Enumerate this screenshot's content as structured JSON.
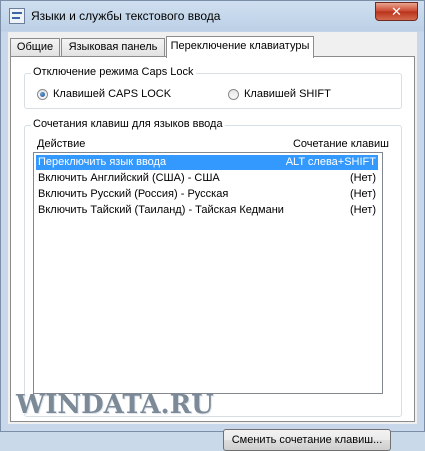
{
  "window": {
    "title": "Языки и службы текстового ввода",
    "close_symbol": "✕"
  },
  "tabs": [
    {
      "label": "Общие",
      "active": false
    },
    {
      "label": "Языковая панель",
      "active": false
    },
    {
      "label": "Переключение клавиатуры",
      "active": true
    }
  ],
  "caps_lock": {
    "group_title": "Отключение режима Caps Lock",
    "options": [
      {
        "label": "Клавишей CAPS LOCK",
        "selected": true
      },
      {
        "label": "Клавишей SHIFT",
        "selected": false
      }
    ]
  },
  "hotkeys": {
    "group_title": "Сочетания клавиш для языков ввода",
    "columns": [
      "Действие",
      "Сочетание клавиш"
    ],
    "rows": [
      {
        "action": "Переключить язык ввода",
        "shortcut": "ALT слева+SHIFT",
        "selected": true
      },
      {
        "action": "Включить Английский (США) - США",
        "shortcut": "(Нет)",
        "selected": false
      },
      {
        "action": "Включить Русский (Россия) - Русская",
        "shortcut": "(Нет)",
        "selected": false
      },
      {
        "action": "Включить Тайский (Таиланд) - Тайская Кедмани",
        "shortcut": "(Нет)",
        "selected": false
      }
    ],
    "change_button": "Сменить сочетание клавиш..."
  },
  "watermark": "WINDATA.RU"
}
